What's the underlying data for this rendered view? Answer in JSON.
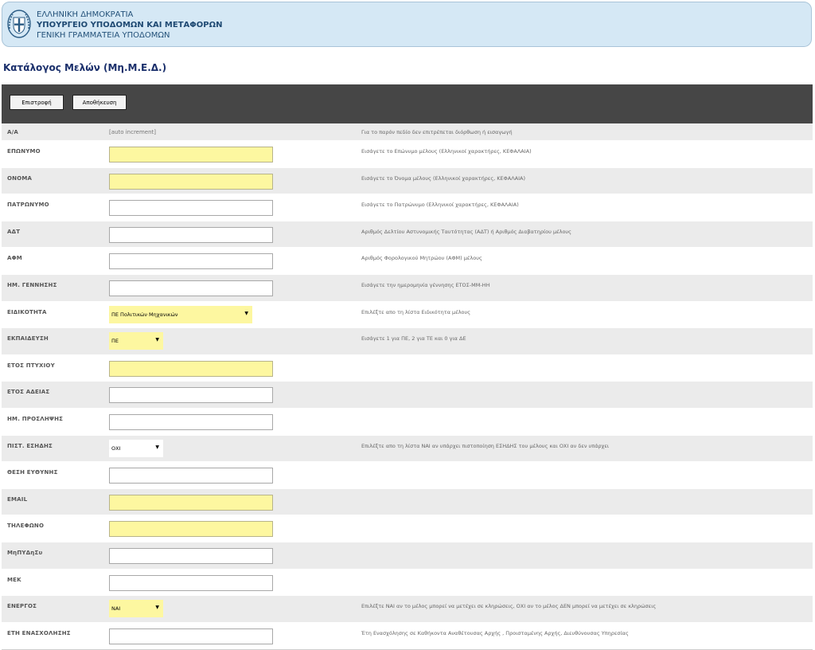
{
  "header": {
    "line1": "ΕΛΛΗΝΙΚΗ ΔΗΜΟΚΡΑΤΙΑ",
    "line2": "ΥΠΟΥΡΓΕΙΟ ΥΠΟΔΟΜΩΝ ΚΑΙ ΜΕΤΑΦΟΡΩΝ",
    "line3": "ΓΕΝΙΚΗ ΓΡΑΜΜΑΤΕΙΑ ΥΠΟΔΟΜΩΝ"
  },
  "page_title": "Κατάλογος Μελών (Μη.Μ.Ε.Δ.)",
  "toolbar": {
    "back_label": "Επιστροφή",
    "save_label": "Αποθήκευση"
  },
  "form": {
    "aa": {
      "label": "Α/Α",
      "value": "[auto increment]",
      "hint": "Για το παρόν πεδίο δεν επιτρέπεται διόρθωση ή εισαγωγή"
    },
    "surname": {
      "label": "ΕΠΩΝΥΜΟ",
      "hint": "Εισάγετε το Επώνυμο μέλους (Ελληνικοί χαρακτήρες, ΚΕΦΑΛΑΙΑ)"
    },
    "name": {
      "label": "ΟΝΟΜΑ",
      "hint": "Εισάγετε το Όνομα μέλους (Ελληνικοί χαρακτήρες, ΚΕΦΑΛΑΙΑ)"
    },
    "patronymic": {
      "label": "ΠΑΤΡΩΝΥΜΟ",
      "hint": "Εισάγετε το Πατρώνυμο (Ελληνικοί χαρακτήρες, ΚΕΦΑΛΑΙΑ)"
    },
    "adt": {
      "label": "ΑΔΤ",
      "hint": "Αριθμός Δελτίου Αστυνομικής Ταυτότητας (ΑΔΤ) ή Αριθμός Διαβατηρίου μέλους"
    },
    "afm": {
      "label": "ΑΦΜ",
      "hint": "Αριθμός Φορολογικού Μητρώου (ΑΦΜ) μέλους"
    },
    "birthdate": {
      "label": "ΗΜ. ΓΕΝΝΗΣΗΣ",
      "hint": "Εισάγετε την ημερομηνία γέννησης ΕΤΟΣ-ΜΜ-ΗΗ"
    },
    "specialty": {
      "label": "ΕΙΔΙΚΟΤΗΤΑ",
      "selected": "ΠΕ Πολιτικών Μηχανικών",
      "hint": "Επιλέξτε απο τη λίστα Ειδικότητα μέλους"
    },
    "education": {
      "label": "ΕΚΠΑΙΔΕΥΣΗ",
      "selected": "ΠΕ",
      "hint": "Εισάγετε 1 για ΠΕ, 2 για ΤΕ και 0 για ΔΕ"
    },
    "degree_year": {
      "label": "ΕΤΟΣ ΠΤΥΧΙΟΥ",
      "hint": ""
    },
    "license_year": {
      "label": "ΕΤΟΣ ΑΔΕΙΑΣ",
      "hint": ""
    },
    "hire_date": {
      "label": "ΗΜ. ΠΡΟΣΛΗΨΗΣ",
      "hint": ""
    },
    "esdis": {
      "label": "ΠΙΣΤ. ΕΣΗΔΗΣ",
      "selected": "ΟΧΙ",
      "hint": "Επιλέξτε απο τη λίστα ΝΑΙ αν υπάρχει πιστοποίηση ΕΣΗΔΗΣ του μέλους και ΟΧΙ αν δεν υπάρχει"
    },
    "position": {
      "label": "ΘΕΣΗ ΕΥΘΥΝΗΣ",
      "hint": ""
    },
    "email": {
      "label": "EMAIL",
      "hint": ""
    },
    "phone": {
      "label": "ΤΗΛΕΦΩΝΟ",
      "hint": ""
    },
    "mitpydisu": {
      "label": "ΜηΠΥΔηΣυ",
      "hint": ""
    },
    "mek": {
      "label": "ΜΕΚ",
      "hint": ""
    },
    "active": {
      "label": "ΕΝΕΡΓΟΣ",
      "selected": "ΝΑΙ",
      "hint": "Επιλέξτε ΝΑΙ αν το μέλος μπορεί να μετέχει σε κληρώσεις, ΟΧΙ αν το μέλος ΔΕΝ μπορεί να μετέχει σε κληρώσεις"
    },
    "years_exp": {
      "label": "ΕΤΗ ΕΝΑΣΧΟΛΗΣΗΣ",
      "hint": "Έτη Ενασχόλησης σε Καθήκοντα Αναθέτουσας Αρχής , Προισταμένης Αρχής, Διευθύνουσας Υπηρεσίας"
    }
  }
}
